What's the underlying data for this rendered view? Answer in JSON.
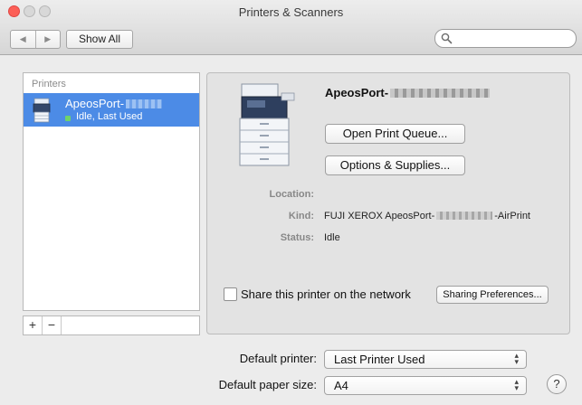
{
  "window": {
    "title": "Printers & Scanners"
  },
  "toolbar": {
    "back_icon": "◀",
    "forward_icon": "▶",
    "show_all_label": "Show All",
    "search_placeholder": ""
  },
  "printer_list": {
    "header": "Printers",
    "items": [
      {
        "name": "ApeosPort-",
        "status": "Idle, Last Used",
        "selected": true
      }
    ],
    "add_label": "+",
    "remove_label": "−"
  },
  "detail": {
    "printer_name": "ApeosPort-",
    "open_queue_label": "Open Print Queue...",
    "options_label": "Options & Supplies...",
    "location_label": "Location:",
    "location_value": "",
    "kind_label": "Kind:",
    "kind_prefix": "FUJI XEROX ApeosPort-",
    "kind_suffix": "-AirPrint",
    "status_label": "Status:",
    "status_value": "Idle",
    "share_label": "Share this printer on the network",
    "share_checked": false,
    "sharing_prefs_label": "Sharing Preferences..."
  },
  "defaults": {
    "printer_label": "Default printer:",
    "printer_value": "Last Printer Used",
    "paper_label": "Default paper size:",
    "paper_value": "A4"
  },
  "help_label": "?",
  "colors": {
    "selection": "#4c8be6",
    "close_button": "#fc5f57",
    "status_ok": "#6fd36b"
  }
}
